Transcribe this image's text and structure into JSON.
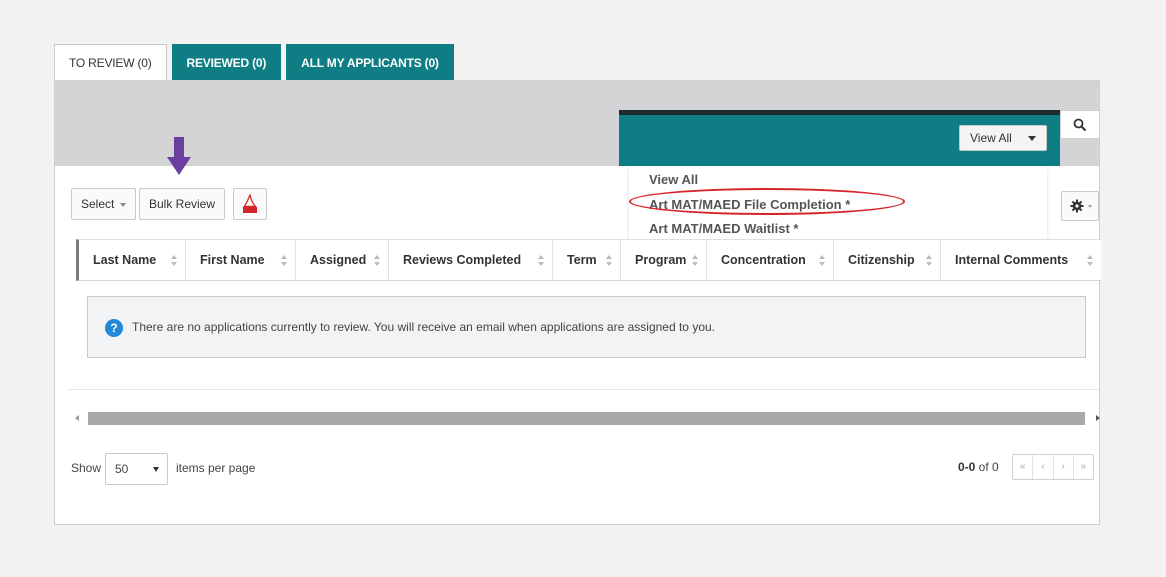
{
  "tabs": [
    {
      "label": "TO REVIEW (0)",
      "active": true
    },
    {
      "label": "REVIEWED (0)",
      "active": false
    },
    {
      "label": "ALL MY APPLICANTS (0)",
      "active": false
    }
  ],
  "filter": {
    "view_all_label": "View All",
    "options": [
      "View All",
      "Art MAT/MAED File Completion *",
      "Art MAT/MAED Waitlist *"
    ],
    "highlighted_option_index": 1
  },
  "toolbar": {
    "select_label": "Select",
    "bulk_review_label": "Bulk Review",
    "pdf_icon": "pdf-icon",
    "settings_icon": "gear-icon",
    "search_icon": "search-icon"
  },
  "table": {
    "columns": [
      "Last Name",
      "First Name",
      "Assigned",
      "Reviews Completed",
      "Term",
      "Program",
      "Concentration",
      "Citizenship",
      "Internal Comments"
    ],
    "empty_message": "There are no applications currently to review. You will receive an email when applications are assigned to you."
  },
  "pagination": {
    "show_label": "Show",
    "per_page_value": "50",
    "items_per_page_label": "items per page",
    "range_bold": "0-0",
    "range_rest": " of 0",
    "buttons": [
      "«",
      "‹",
      "›",
      "»"
    ]
  },
  "colors": {
    "teal": "#0f7d84",
    "annotation_arrow": "#6b3fa0",
    "annotation_oval": "#d7262b",
    "info_blue": "#2389d6"
  }
}
